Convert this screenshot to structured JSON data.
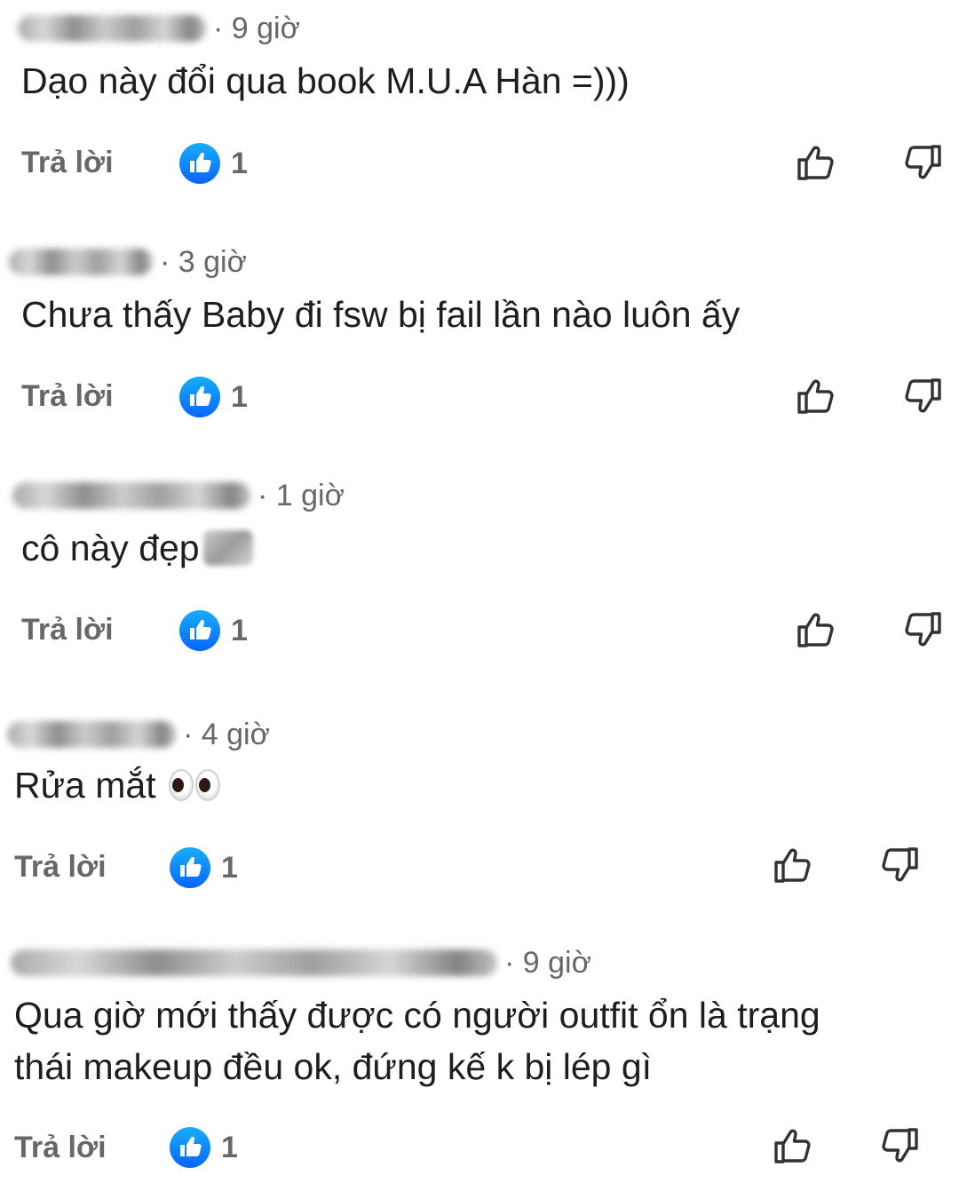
{
  "comments": [
    {
      "time": "· 9 giờ",
      "text": "Dạo này đổi qua book M.U.A Hàn =)))",
      "reply_label": "Trả lời",
      "like_count": "1"
    },
    {
      "time": "· 3 giờ",
      "text": "Chưa thấy Baby đi fsw bị fail lần nào luôn ấy",
      "reply_label": "Trả lời",
      "like_count": "1"
    },
    {
      "time": "· 1 giờ",
      "text": "cô này đẹp",
      "reply_label": "Trả lời",
      "like_count": "1"
    },
    {
      "time": "· 4 giờ",
      "text": "Rửa mắt",
      "reply_label": "Trả lời",
      "like_count": "1"
    },
    {
      "time": "· 9 giờ",
      "text_line1": "Qua giờ mới thấy được có người outfit ổn là trạng",
      "text_line2": "thái makeup đều ok, đứng kế k bị lép gì",
      "reply_label": "Trả lời",
      "like_count": "1"
    }
  ],
  "icons": {
    "like_badge": "like-badge-icon",
    "upvote": "thumbs-up-outline-icon",
    "downvote": "thumbs-down-outline-icon",
    "eyes_emoji": "eyes-emoji-icon"
  },
  "colors": {
    "like_blue": "#1877f2",
    "muted_text": "#65676b",
    "body_text": "#1c1e21"
  }
}
